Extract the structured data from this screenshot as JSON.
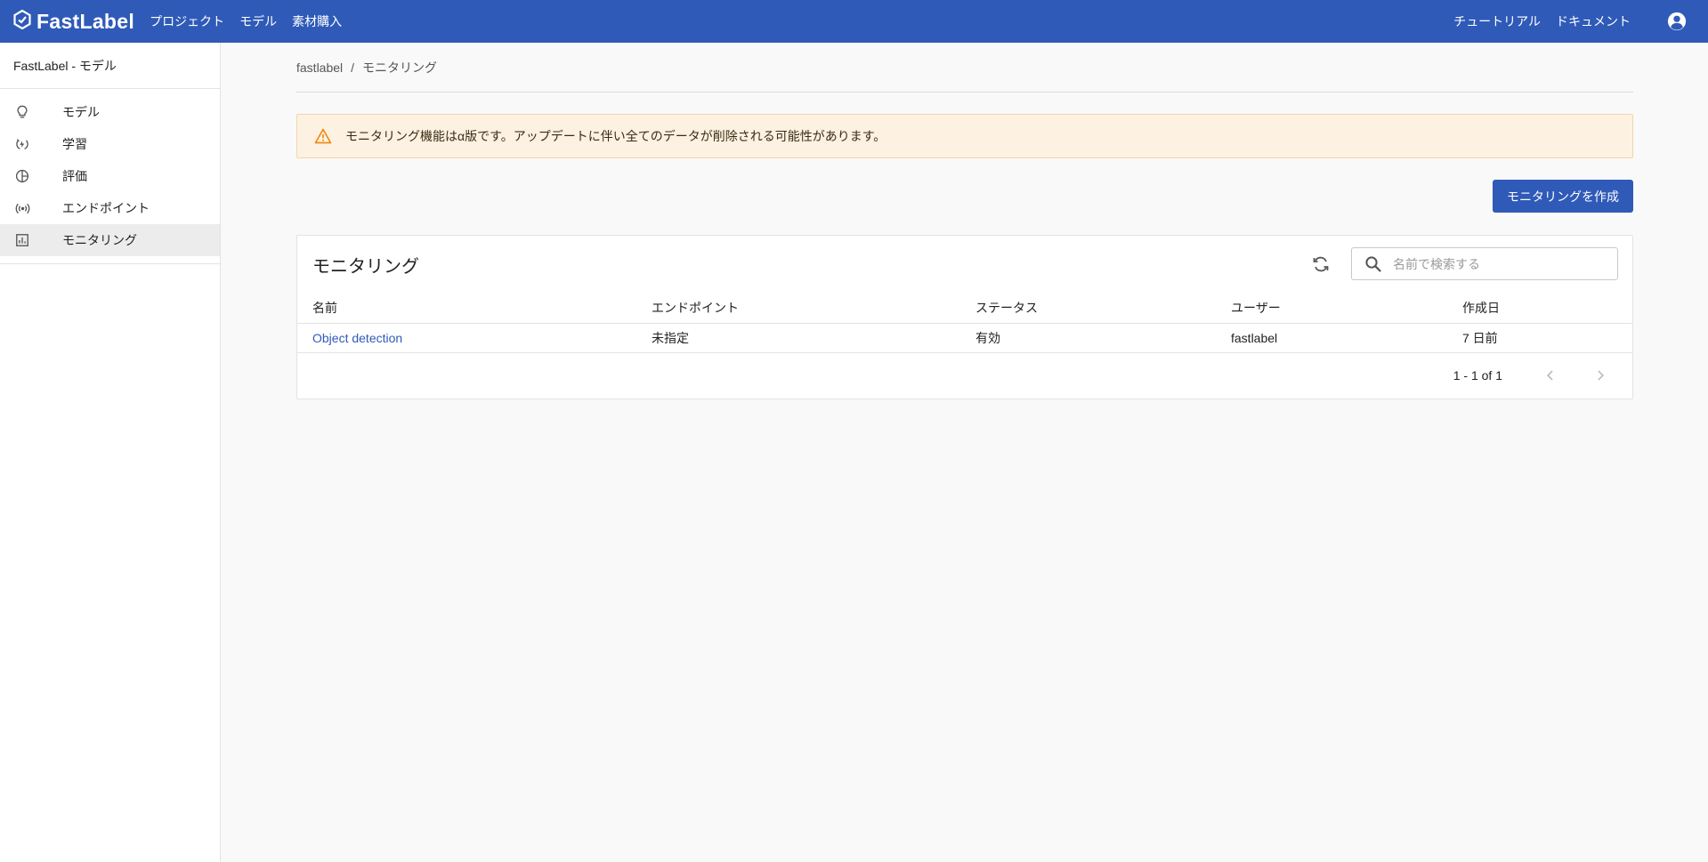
{
  "app": {
    "logo_text": "FastLabel",
    "nav": [
      "プロジェクト",
      "モデル",
      "素材購入"
    ],
    "right_links": [
      "チュートリアル",
      "ドキュメント"
    ],
    "brand_color": "#2f5ab8"
  },
  "sidebar": {
    "title": "FastLabel - モデル",
    "items": [
      {
        "label": "モデル",
        "icon": "lightbulb-icon"
      },
      {
        "label": "学習",
        "icon": "training-icon"
      },
      {
        "label": "評価",
        "icon": "pie-chart-icon"
      },
      {
        "label": "エンドポイント",
        "icon": "broadcast-icon"
      },
      {
        "label": "モニタリング",
        "icon": "bar-chart-icon",
        "active": true
      }
    ]
  },
  "breadcrumb": [
    "fastlabel",
    "モニタリング"
  ],
  "alert": {
    "message": "モニタリング機能はα版です。アップデートに伴い全てのデータが削除される可能性があります。",
    "icon": "warning-icon"
  },
  "create_button": "モニタリングを作成",
  "card": {
    "title": "モニタリング",
    "search_placeholder": "名前で検索する",
    "columns": [
      "名前",
      "エンドポイント",
      "ステータス",
      "ユーザー",
      "作成日"
    ],
    "rows": [
      {
        "name": "Object detection",
        "endpoint": "未指定",
        "status": "有効",
        "user": "fastlabel",
        "created": "7 日前"
      }
    ],
    "pagination": "1 - 1 of 1"
  }
}
